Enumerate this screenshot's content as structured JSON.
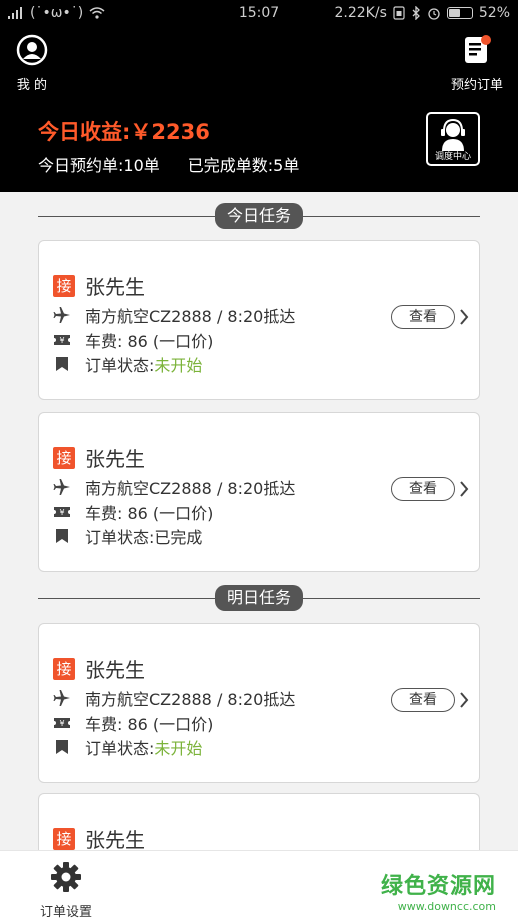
{
  "status_bar": {
    "signal_text": "(˙•ω•˙)",
    "time": "15:07",
    "net_speed": "2.22K/s",
    "battery": "52%",
    "battery_level": 0.52
  },
  "header": {
    "profile_label": "我 的",
    "orders_label": "预约订单",
    "earnings": "今日收益:￥2236",
    "today_bookings": "今日预约单:10单",
    "completed": "已完成单数:5单",
    "dispatch_label": "调度中心"
  },
  "sections": {
    "today": "今日任务",
    "tomorrow": "明日任务"
  },
  "cards": [
    {
      "badge": "接",
      "name": "张先生",
      "flight": "南方航空CZ2888 / 8:20抵达",
      "fare": "车费: 86 (一口价)",
      "status_label": "订单状态:",
      "status_value": "未开始",
      "view": "查看"
    },
    {
      "badge": "接",
      "name": "张先生",
      "flight": "南方航空CZ2888 / 8:20抵达",
      "fare": "车费: 86 (一口价)",
      "status_label": "订单状态:",
      "status_value": "已完成",
      "view": "查看"
    },
    {
      "badge": "接",
      "name": "张先生",
      "flight": "南方航空CZ2888 / 8:20抵达",
      "fare": "车费: 86 (一口价)",
      "status_label": "订单状态:",
      "status_value": "未开始",
      "view": "查看"
    },
    {
      "badge": "接",
      "name": "张先生"
    }
  ],
  "bottom_nav": {
    "settings_label": "订单设置"
  },
  "watermark": {
    "title": "绿色资源网",
    "url": "www.downcc.com"
  },
  "colors": {
    "accent": "#f0542c",
    "pending": "#7bb33a",
    "header_bg": "#000000"
  },
  "icons": [
    "signal-icon",
    "wifi-icon",
    "bluetooth-icon",
    "alarm-icon",
    "battery-icon",
    "avatar-icon",
    "order-list-icon",
    "headset-icon",
    "plane-icon",
    "ticket-icon",
    "bookmark-icon",
    "chevron-right-icon",
    "gear-icon"
  ]
}
